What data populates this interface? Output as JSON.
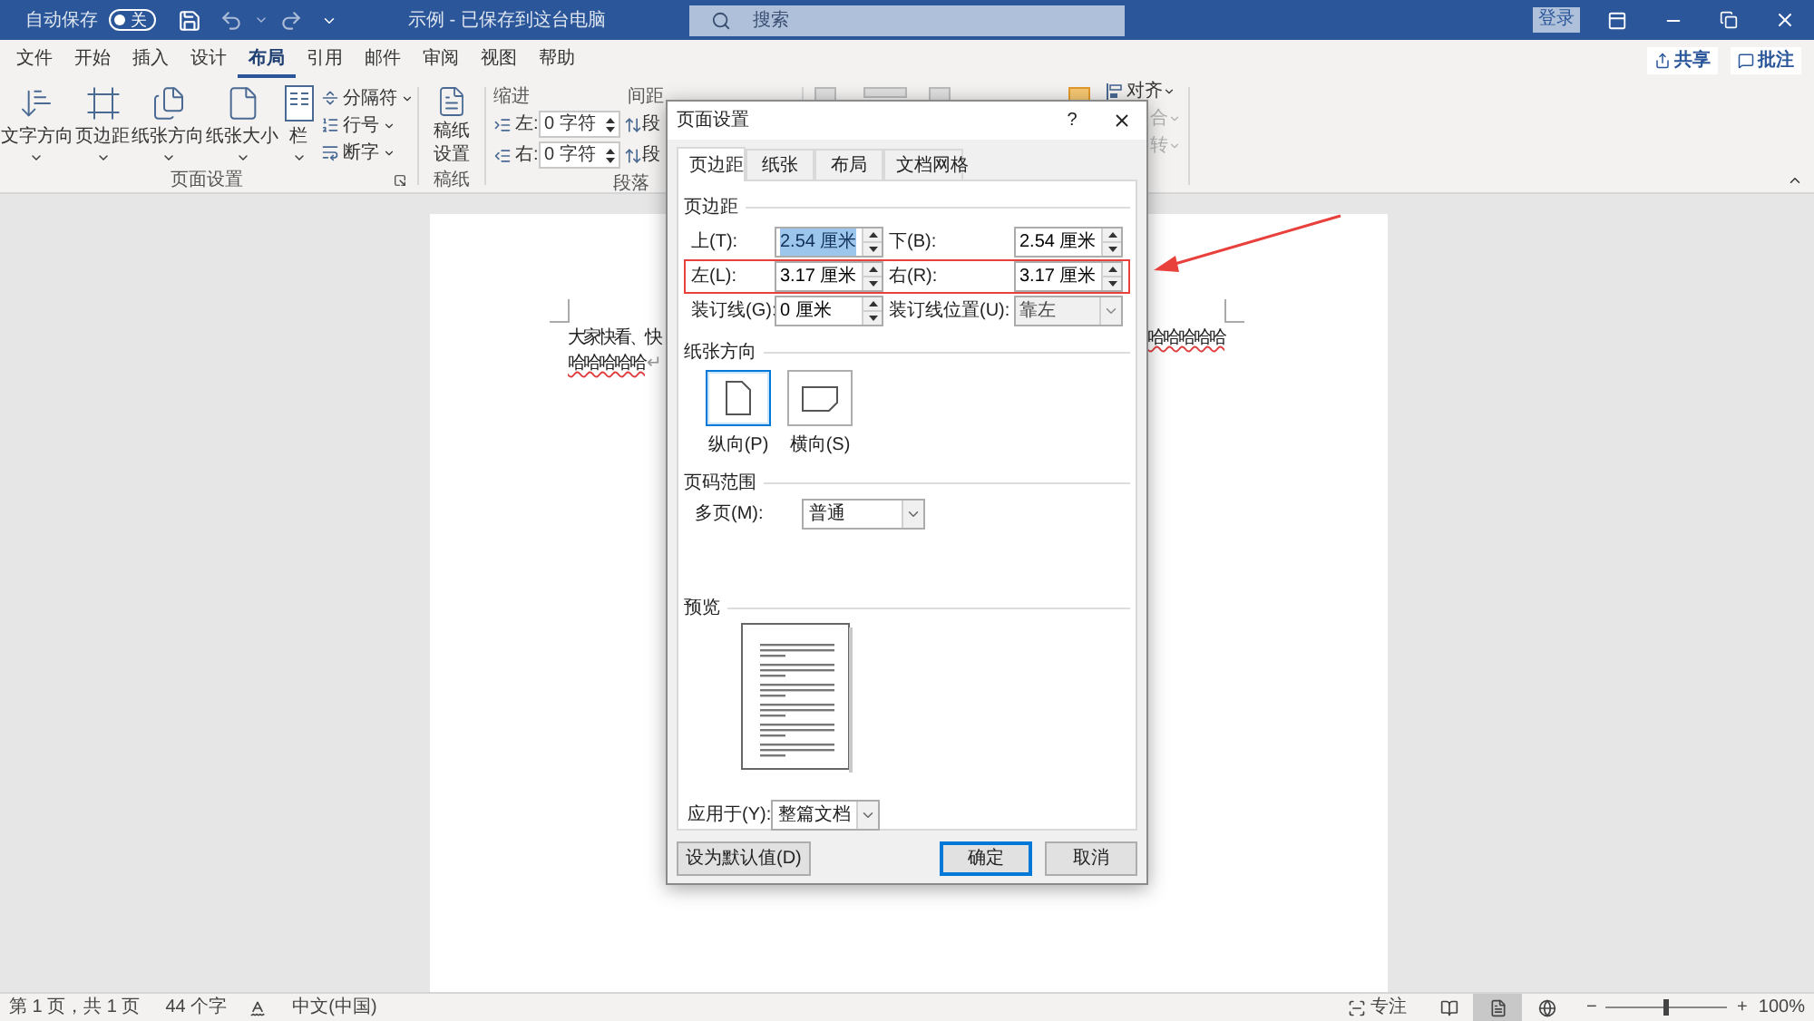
{
  "title_bar": {
    "autosave_label": "自动保存",
    "autosave_on": false,
    "autosave_state": "关",
    "document_title": "示例 - 已保存到这台电脑",
    "search_placeholder": "搜索",
    "sign_in": "登录"
  },
  "menu_tabs": [
    {
      "label": "文件",
      "selected": false
    },
    {
      "label": "开始",
      "selected": false
    },
    {
      "label": "插入",
      "selected": false
    },
    {
      "label": "设计",
      "selected": false
    },
    {
      "label": "布局",
      "selected": true
    },
    {
      "label": "引用",
      "selected": false
    },
    {
      "label": "邮件",
      "selected": false
    },
    {
      "label": "审阅",
      "selected": false
    },
    {
      "label": "视图",
      "selected": false
    },
    {
      "label": "帮助",
      "selected": false
    }
  ],
  "share_button": "共享",
  "comments_button": "批注",
  "ribbon": {
    "page_setup": {
      "label": "页面设置",
      "large_buttons": [
        {
          "label": "文字方向",
          "kind": "text-direction"
        },
        {
          "label": "页边距",
          "kind": "margins"
        },
        {
          "label": "纸张方向",
          "kind": "orientation"
        },
        {
          "label": "纸张大小",
          "kind": "size"
        },
        {
          "label": "栏",
          "kind": "columns"
        }
      ],
      "small_buttons": [
        {
          "label": "分隔符",
          "kind": "breaks"
        },
        {
          "label": "行号",
          "kind": "line-numbers"
        },
        {
          "label": "断字",
          "kind": "hyphenation"
        }
      ]
    },
    "manuscript": {
      "label": "稿纸",
      "button": "稿纸设置"
    },
    "paragraph": {
      "label": "段落",
      "indent_title": "缩进",
      "spacing_title": "间距",
      "rows": [
        {
          "label": "左:",
          "value": "0 字符",
          "spacing": "段"
        },
        {
          "label": "右:",
          "value": "0 字符",
          "spacing": "段"
        }
      ]
    },
    "arrange": {
      "items": [
        {
          "label": "对齐",
          "disabled": false
        },
        {
          "label": "合",
          "disabled": true
        },
        {
          "label": "转",
          "disabled": true
        }
      ]
    }
  },
  "document": {
    "lines": [
      {
        "segments": [
          {
            "text": "大家快看、快",
            "misspelled": false
          },
          {
            "text": "哈哈哈哈哈",
            "misspelled": true
          }
        ]
      },
      {
        "segments": [
          {
            "text": "哈哈哈哈哈",
            "misspelled": true
          }
        ],
        "mark": "↵"
      }
    ]
  },
  "dialog": {
    "title": "页面设置",
    "help": "?",
    "tabs": [
      {
        "label": "页边距",
        "selected": true
      },
      {
        "label": "纸张",
        "selected": false
      },
      {
        "label": "布局",
        "selected": false
      },
      {
        "label": "文档网格",
        "selected": false
      }
    ],
    "margins_title": "页边距",
    "margin_fields": [
      {
        "label": "上(T):",
        "value": "2.54 厘米",
        "kind": "spin",
        "text_selected": true,
        "disabled": false
      },
      {
        "label": "下(B):",
        "value": "2.54 厘米",
        "kind": "spin",
        "text_selected": false,
        "disabled": false
      },
      {
        "label": "左(L):",
        "value": "3.17 厘米",
        "kind": "spin",
        "text_selected": false,
        "disabled": false
      },
      {
        "label": "右(R):",
        "value": "3.17 厘米",
        "kind": "spin",
        "text_selected": false,
        "disabled": false
      },
      {
        "label": "装订线(G):",
        "value": "0 厘米",
        "kind": "spin",
        "text_selected": false,
        "disabled": false
      },
      {
        "label": "装订线位置(U):",
        "value": "靠左",
        "kind": "dropdown",
        "text_selected": false,
        "disabled": true
      }
    ],
    "orientation_title": "纸张方向",
    "orientations": [
      {
        "label": "纵向(P)",
        "kind": "portrait",
        "selected": true
      },
      {
        "label": "横向(S)",
        "kind": "landscape",
        "selected": false
      }
    ],
    "pages_title": "页码范围",
    "multiple_pages": {
      "label": "多页(M):",
      "value": "普通"
    },
    "preview_title": "预览",
    "apply_to": {
      "label": "应用于(Y):",
      "value": "整篇文档"
    },
    "buttons": [
      {
        "label": "设为默认值(D)",
        "default": false
      },
      {
        "label": "确定",
        "default": true
      },
      {
        "label": "取消",
        "default": false
      }
    ]
  },
  "status_bar": {
    "page": "第 1 页，共 1 页",
    "words": "44 个字",
    "language": "中文(中国)",
    "focus": "专注",
    "views": [
      {
        "kind": "read",
        "selected": false
      },
      {
        "kind": "print",
        "selected": true
      },
      {
        "kind": "web",
        "selected": false
      }
    ],
    "zoom_minus": "−",
    "zoom_slider": {
      "level": 0.5
    },
    "zoom_plus": "+",
    "zoom": "100%"
  }
}
